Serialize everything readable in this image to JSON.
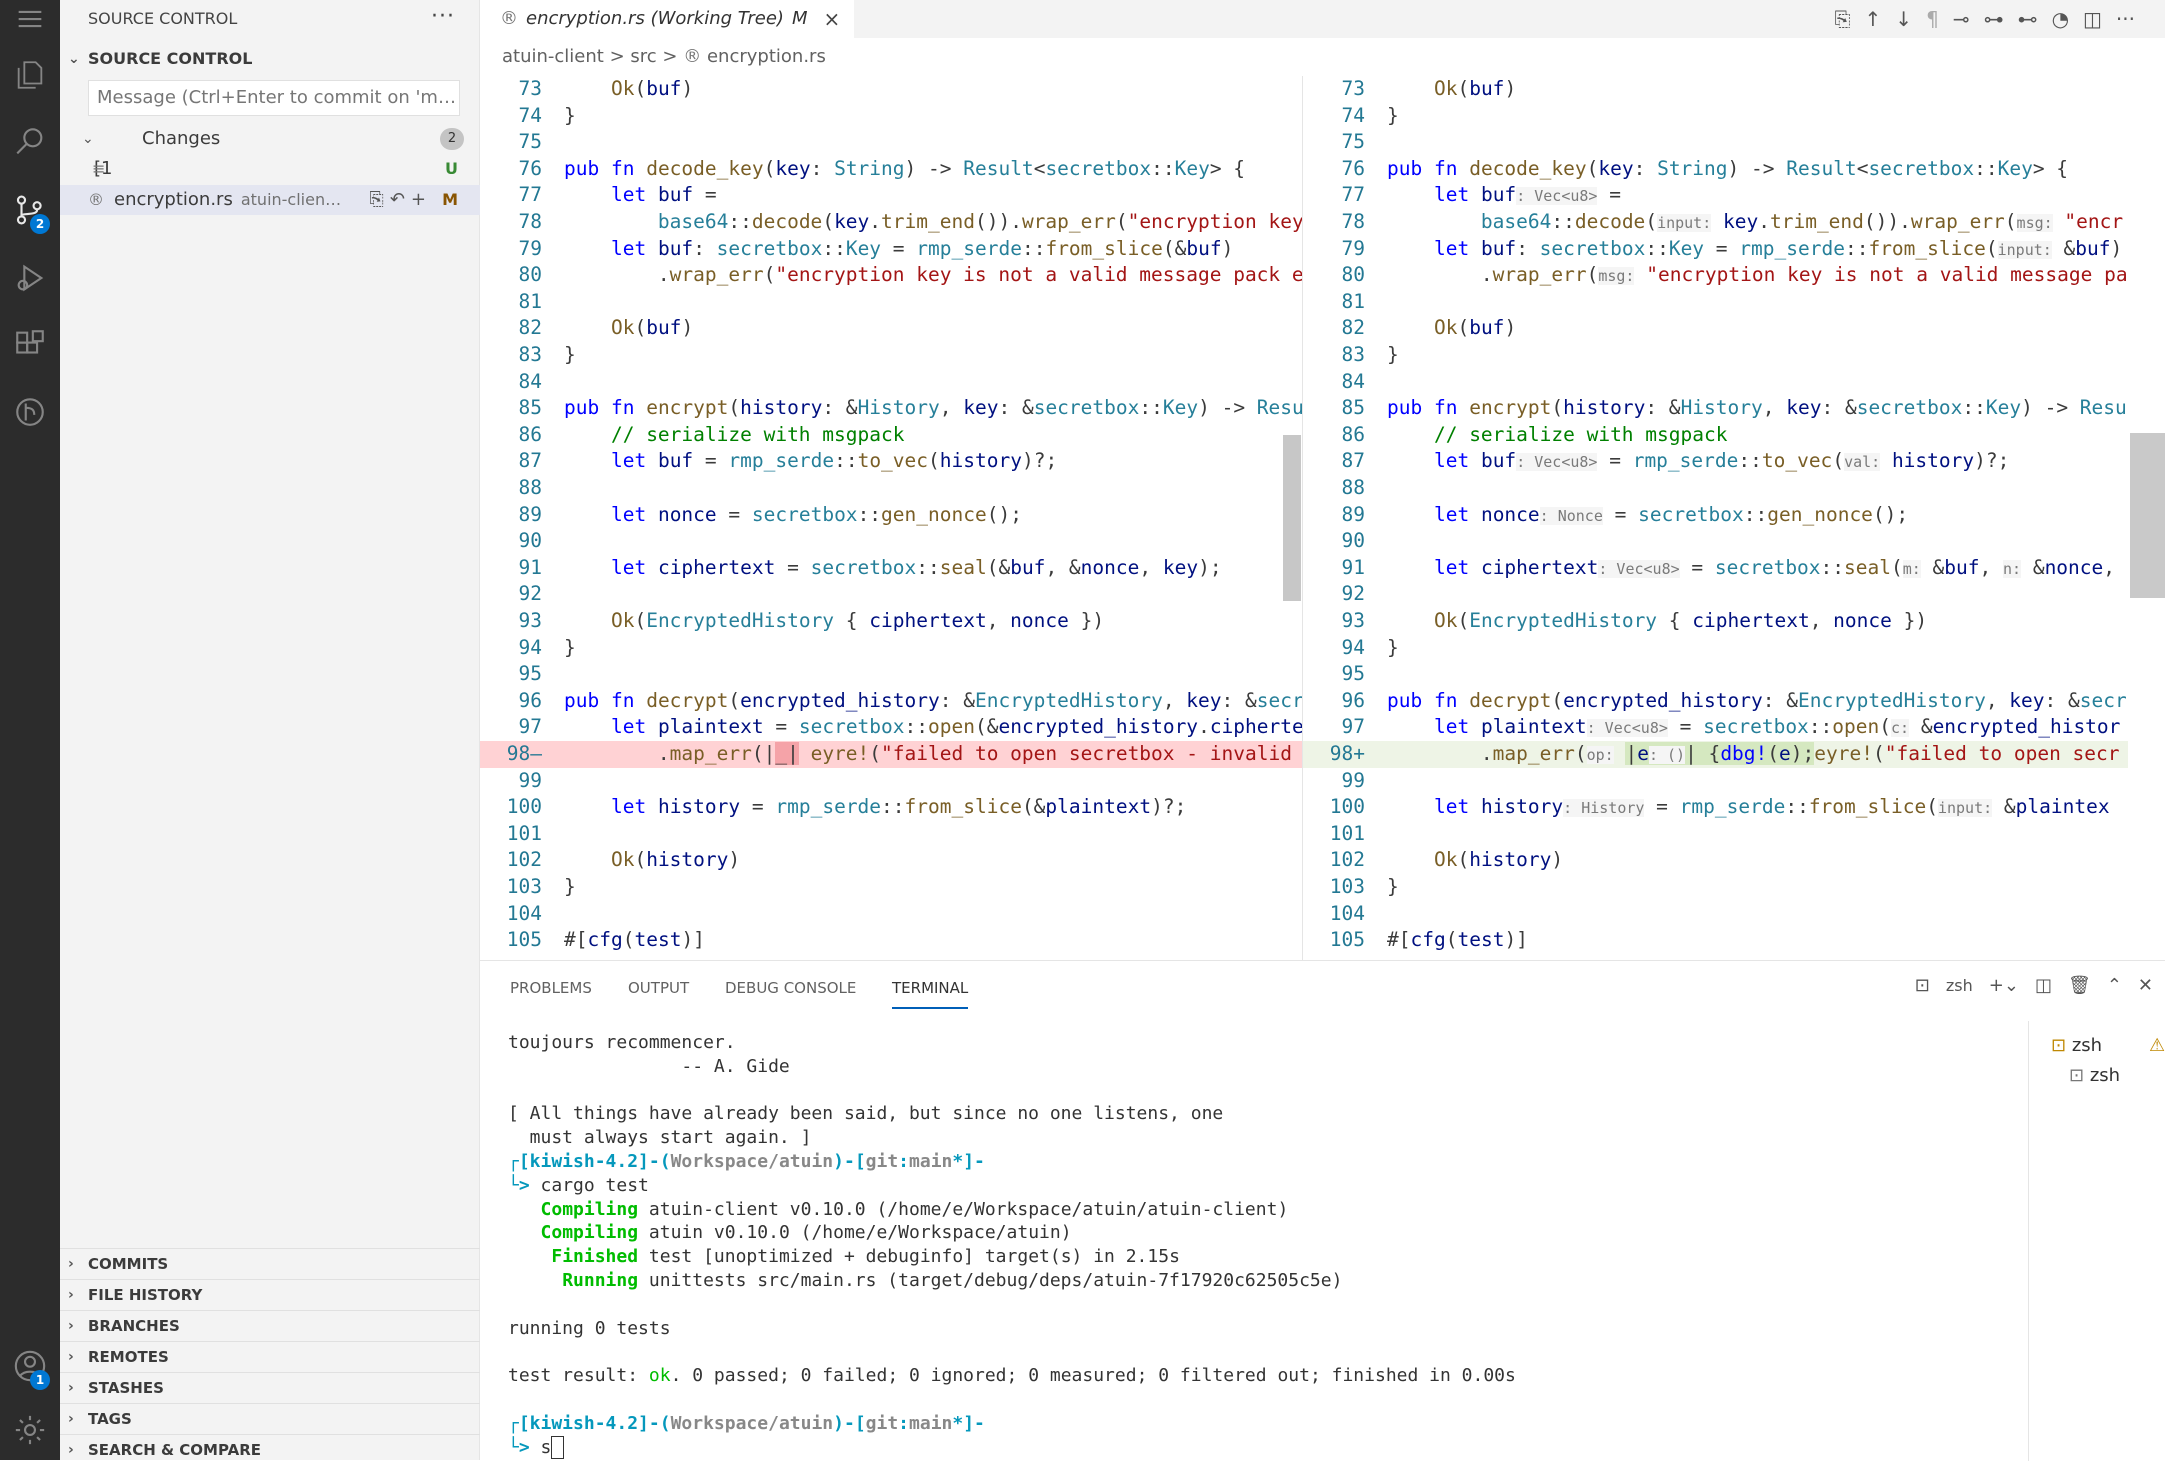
{
  "activity_bar": {
    "source_control_badge": "2",
    "account_badge": "1"
  },
  "sidebar": {
    "title": "SOURCE CONTROL",
    "more": "···",
    "section": "SOURCE CONTROL",
    "commit_placeholder": "Message (Ctrl+Enter to commit on 'm…",
    "changes_label": "Changes",
    "changes_count": "2",
    "files": [
      {
        "name": "[1",
        "path": "",
        "status": "U"
      },
      {
        "name": "encryption.rs",
        "path": "atuin-clien…",
        "status": "M"
      }
    ],
    "collapsed_sections": [
      "COMMITS",
      "FILE HISTORY",
      "BRANCHES",
      "REMOTES",
      "STASHES",
      "TAGS",
      "SEARCH & COMPARE"
    ]
  },
  "tab": {
    "label": "encryption.rs (Working Tree)",
    "modified": "M",
    "close": "×"
  },
  "breadcrumb": {
    "root": "atuin-client",
    "sep": ">",
    "folder": "src",
    "file": "encryption.rs"
  },
  "panel": {
    "tabs": [
      "PROBLEMS",
      "OUTPUT",
      "DEBUG CONSOLE",
      "TERMINAL"
    ],
    "active_tab": "TERMINAL",
    "shell": "zsh",
    "terminals": [
      "zsh",
      "zsh"
    ]
  },
  "colors": {
    "accent": "#005fb8",
    "deleted_line": "#ffd2d4",
    "added_line": "#eef4e6"
  }
}
